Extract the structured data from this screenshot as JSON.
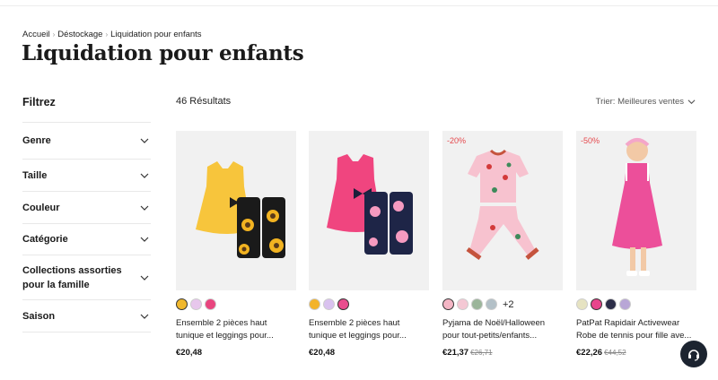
{
  "breadcrumb": {
    "items": [
      "Accueil",
      "Déstockage",
      "Liquidation pour enfants"
    ],
    "separator": "›"
  },
  "page_title": "Liquidation pour enfants",
  "filters": {
    "title": "Filtrez",
    "items": [
      {
        "label": "Genre"
      },
      {
        "label": "Taille"
      },
      {
        "label": "Couleur"
      },
      {
        "label": "Catégorie"
      },
      {
        "label": "Collections assorties pour la famille"
      },
      {
        "label": "Saison"
      }
    ]
  },
  "results_count": "46 Résultats",
  "sort_label": "Trier: Meilleures ventes",
  "products": [
    {
      "name": "Ensemble 2 pièces haut tunique et leggings pour...",
      "price": "€20,48",
      "old_price": "",
      "badge": "",
      "swatch_colors": [
        "#f0b82e",
        "#e7c7ec",
        "#e8457e"
      ],
      "more_colors": ""
    },
    {
      "name": "Ensemble 2 pièces haut tunique et leggings pour...",
      "price": "€20,48",
      "old_price": "",
      "badge": "",
      "swatch_colors": [
        "#f3b32a",
        "#d9c2ef",
        "#e94d8e"
      ],
      "more_colors": ""
    },
    {
      "name": "Pyjama de Noël/Halloween pour tout-petits/enfants...",
      "price": "€21,37",
      "old_price": "€26,71",
      "badge": "-20%",
      "swatch_colors": [
        "#f4b6c5",
        "#f4c8d4",
        "#9bb59a",
        "#b3c0c7"
      ],
      "more_colors": "+2"
    },
    {
      "name": "PatPat Rapidair Activewear Robe de tennis pour fille ave...",
      "price": "€22,26",
      "old_price": "€44,52",
      "badge": "-50%",
      "swatch_colors": [
        "#e6e3c2",
        "#e8458c",
        "#2c2e48",
        "#b8a6d6"
      ],
      "more_colors": ""
    }
  ],
  "icons": {
    "filter_chevron": "chevron-down-icon",
    "sort_chevron": "chevron-down-icon",
    "chat": "headset-icon"
  },
  "colors": {
    "discount": "#e5484d",
    "chat_button": "#1c2430"
  }
}
